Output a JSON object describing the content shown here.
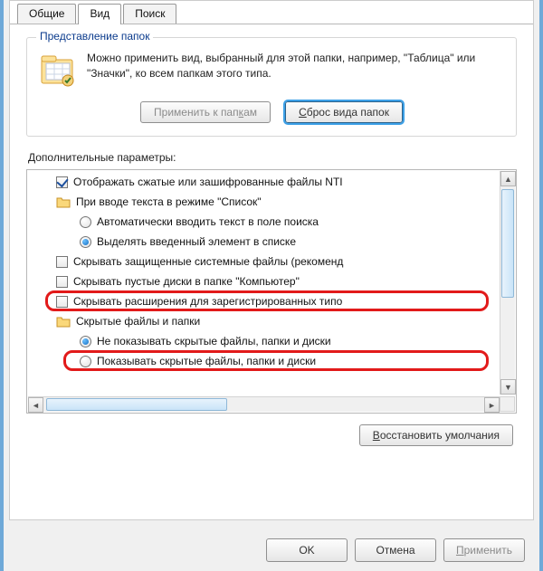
{
  "tabs": {
    "general": "Общие",
    "view": "Вид",
    "search": "Поиск"
  },
  "groupbox": {
    "title": "Представление папок",
    "text": "Можно применить вид, выбранный для этой папки, например, \"Таблица\" или \"Значки\", ко всем папкам этого типа.",
    "apply_to_folders_prefix": "Применить к пап",
    "apply_to_folders_underline": "к",
    "apply_to_folders_suffix": "ам",
    "reset_view_underline": "С",
    "reset_view_suffix": "брос вида папок"
  },
  "advanced_label": "Дополнительные параметры:",
  "tree": {
    "show_compressed": "Отображать сжатые или зашифрованные файлы NTI",
    "list_input_group": "При вводе текста в режиме \"Список\"",
    "auto_type": "Автоматически вводить текст в поле поиска",
    "highlight_entered": "Выделять введенный элемент в списке",
    "hide_protected": "Скрывать защищенные системные файлы (рекоменд",
    "hide_empty_drives": "Скрывать пустые диски в папке \"Компьютер\"",
    "hide_extensions": "Скрывать расширения для зарегистрированных типо",
    "hidden_group": "Скрытые файлы и папки",
    "dont_show_hidden": "Не показывать скрытые файлы, папки и диски",
    "show_hidden": "Показывать скрытые файлы, папки и диски"
  },
  "restore_defaults_underline": "В",
  "restore_defaults_suffix": "осстановить умолчания",
  "buttons": {
    "ok": "OK",
    "cancel": "Отмена",
    "apply_underline": "П",
    "apply_suffix": "рименить"
  }
}
